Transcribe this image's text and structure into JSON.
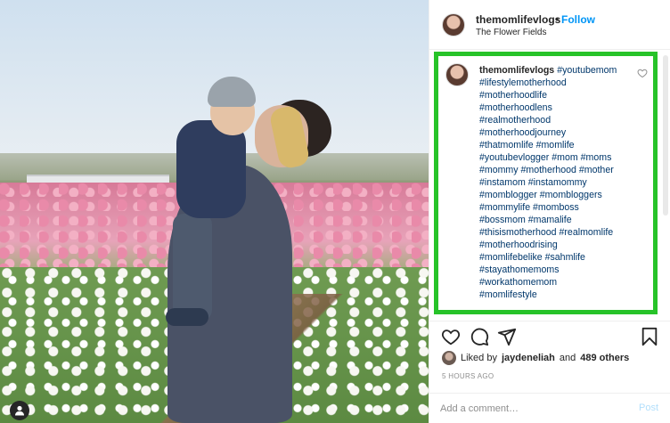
{
  "post": {
    "username": "themomlifevlogs",
    "separator": "•",
    "follow_label": "Follow",
    "location": "The Flower Fields"
  },
  "caption": {
    "username": "themomlifevlogs",
    "lines": [
      "#youtubemom",
      "#lifestylemotherhood",
      "#motherhoodlife",
      "#motherhoodlens",
      "#realmotherhood",
      "#motherhoodjourney",
      "#thatmomlife #momlife",
      "#youtubevlogger #mom #moms",
      "#mommy #motherhood #mother",
      "#instamom #instamommy",
      "#momblogger #mombloggers",
      "#mommylife #momboss",
      "#bossmom #mamalife",
      "#thisismotherhood #realmomlife",
      "#motherhoodrising",
      "#momlifebelike #sahmlife",
      "#stayathomemoms",
      "#workathomemom",
      "#momlifestyle"
    ]
  },
  "likes": {
    "prefix": "Liked by",
    "user": "jaydeneliah",
    "middle": "and",
    "others": "489 others"
  },
  "timestamp": "5 HOURS AGO",
  "comment": {
    "placeholder": "Add a comment…",
    "post_label": "Post"
  },
  "colors": {
    "highlight": "#27c329",
    "follow": "#0095f6",
    "hashtag": "#00376b",
    "post_disabled": "#b2dffc"
  },
  "icons": [
    "heart-icon",
    "comment-icon",
    "share-icon",
    "bookmark-icon",
    "user-icon"
  ]
}
